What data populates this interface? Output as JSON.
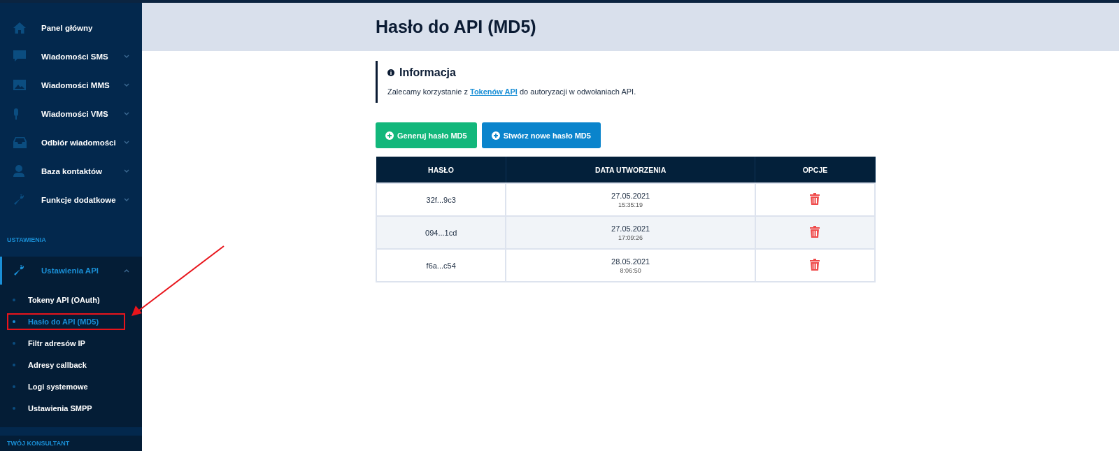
{
  "sidebar": {
    "items": [
      {
        "label": "Panel główny",
        "expandable": false
      },
      {
        "label": "Wiadomości SMS",
        "expandable": true
      },
      {
        "label": "Wiadomości MMS",
        "expandable": true
      },
      {
        "label": "Wiadomości VMS",
        "expandable": true
      },
      {
        "label": "Odbiór wiadomości",
        "expandable": true
      },
      {
        "label": "Baza kontaktów",
        "expandable": true
      },
      {
        "label": "Funkcje dodatkowe",
        "expandable": true
      }
    ],
    "section": "USTAWIENIA",
    "group": {
      "label": "Ustawienia API",
      "expanded": true,
      "children": [
        {
          "label": "Tokeny API (OAuth)",
          "selected": false,
          "highlighted": false
        },
        {
          "label": "Hasło do API (MD5)",
          "selected": true,
          "highlighted": true
        },
        {
          "label": "Filtr adresów IP",
          "selected": false,
          "highlighted": false
        },
        {
          "label": "Adresy callback",
          "selected": false,
          "highlighted": false
        },
        {
          "label": "Logi systemowe",
          "selected": false,
          "highlighted": false
        },
        {
          "label": "Ustawienia SMPP",
          "selected": false,
          "highlighted": false
        }
      ]
    },
    "section_2": "TWÓJ KONSULTANT"
  },
  "page": {
    "title": "Hasło do API (MD5)"
  },
  "info": {
    "title": "Informacja",
    "before": "Zalecamy korzystanie z ",
    "link": "Tokenów API",
    "after": " do autoryzacji w odwołaniach API."
  },
  "buttons": [
    {
      "label": "Generuj hasło MD5",
      "kind": "success"
    },
    {
      "label": "Stwórz nowe hasło MD5",
      "kind": "primary"
    }
  ],
  "table": {
    "columns": [
      "HASŁO",
      "DATA UTWORZENIA",
      "OPCJE"
    ],
    "rows": [
      {
        "password": "32f...9c3",
        "date": "27.05.2021",
        "time": "15:35:19"
      },
      {
        "password": "094...1cd",
        "date": "27.05.2021",
        "time": "17:09:26"
      },
      {
        "password": "f6a...c54",
        "date": "28.05.2021",
        "time": "8:06:50"
      }
    ]
  }
}
